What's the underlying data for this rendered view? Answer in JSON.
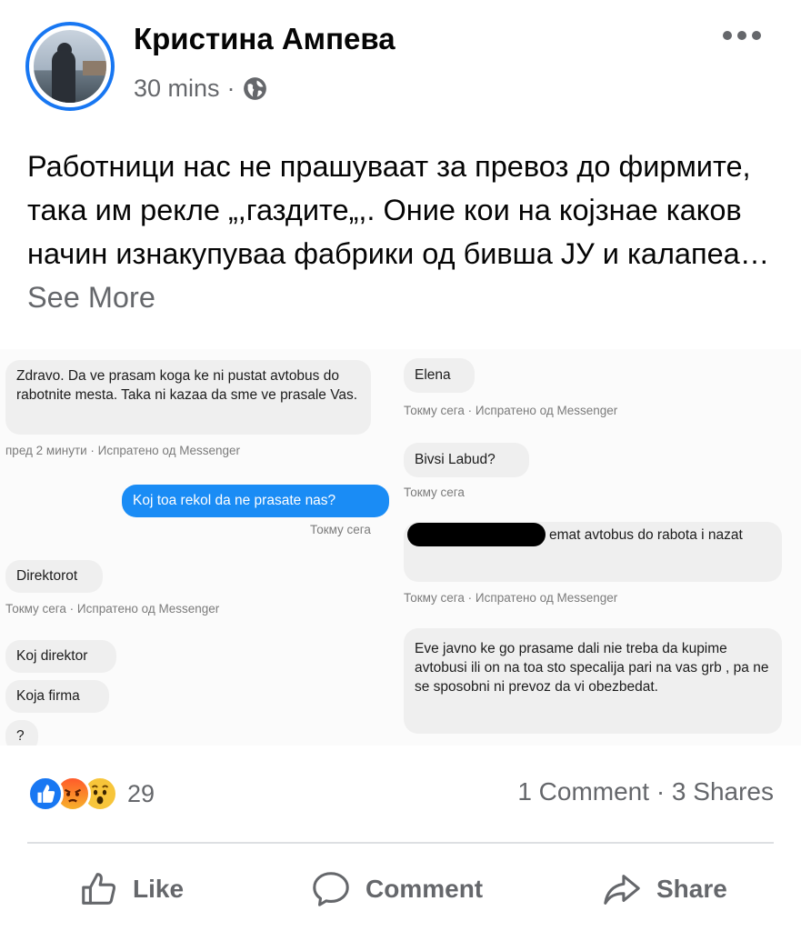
{
  "post": {
    "author": "Кристина Ампева",
    "time": "30 mins",
    "separator": "·",
    "text": "Работници нас не прашуваат за превоз до фирмите, така им рекле „,газдите„,. Оние кои на којзнае каков начин изнакупуваа фабрики од бивша ЈУ и калапеа…",
    "see_more": "See More"
  },
  "messages": {
    "left": [
      {
        "text": "Zdravo. Da ve prasam koga ke ni pustat avtobus do rabotnite mesta. Taka ni kazaa da sme ve prasale Vas."
      },
      {
        "stamp": "пред 2 минути · Испратено од Messenger"
      },
      {
        "text": "Koj toa rekol da ne prasate nas?"
      },
      {
        "stamp": "Токму сега"
      },
      {
        "text": "Direktorot"
      },
      {
        "stamp": "Токму сега · Испратено од Messenger"
      },
      {
        "text": "Koj direktor"
      },
      {
        "text": "Koja firma"
      },
      {
        "text": "?"
      }
    ],
    "right": [
      {
        "text": "Elena"
      },
      {
        "stamp": "Токму сега · Испратено од Messenger"
      },
      {
        "text": "Bivsi Labud?"
      },
      {
        "stamp": "Токму сега"
      },
      {
        "text": "emat avtobus do rabota i nazat"
      },
      {
        "stamp": "Токму сега · Испратено од Messenger"
      },
      {
        "text": "Eve javno ke go prasame dali nie treba da kupime avtobusi ili on na toa sto specalija pari na vas grb , pa ne se sposobni ni prevoz da vi obezbedat."
      }
    ]
  },
  "reactions": {
    "count": "29",
    "types": [
      "like-icon",
      "angry-icon",
      "wow-icon"
    ],
    "comments": "1 Comment",
    "shares": "3 Shares",
    "separator": "·"
  },
  "actions": {
    "like": "Like",
    "comment": "Comment",
    "share": "Share"
  },
  "colors": {
    "accent": "#1877f2",
    "muted": "#65676b",
    "messenger_blue": "#1a8cf5"
  }
}
